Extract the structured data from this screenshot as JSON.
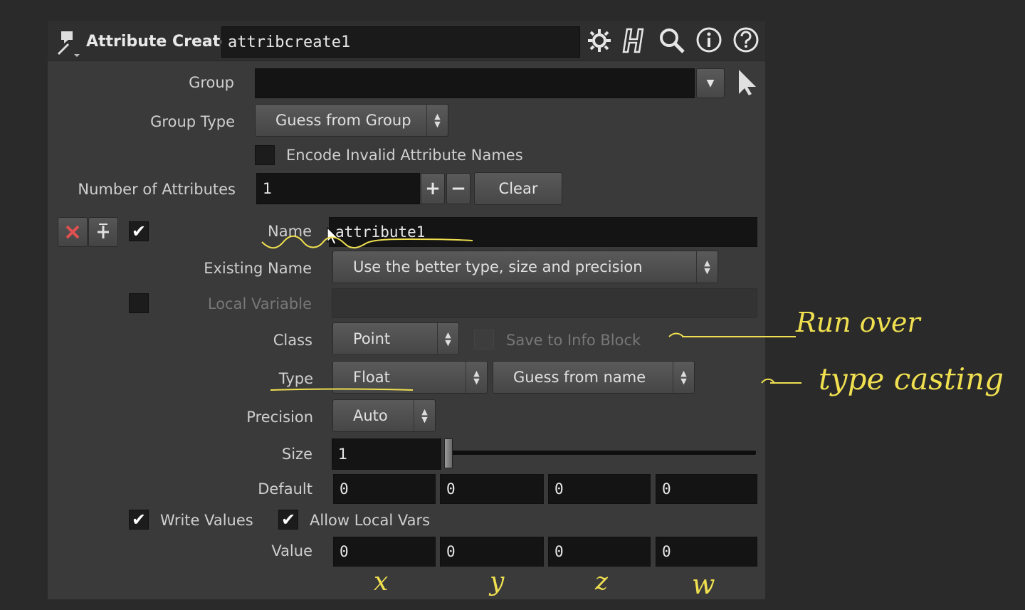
{
  "header": {
    "node_type": "Attribute Create",
    "node_name": "attribcreate1",
    "icons": [
      "gear-icon",
      "houdini-h-icon",
      "magnifier-icon",
      "info-icon",
      "help-icon"
    ]
  },
  "params": {
    "group": {
      "label": "Group",
      "value": ""
    },
    "group_type": {
      "label": "Group Type",
      "value": "Guess from Group"
    },
    "encode_invalid": {
      "label": "Encode Invalid Attribute Names",
      "checked": false
    },
    "num_attributes": {
      "label": "Number of Attributes",
      "value": "1",
      "plus": "+",
      "minus": "−",
      "clear": "Clear"
    },
    "name": {
      "label": "Name",
      "value": "attribute1"
    },
    "existing_name": {
      "label": "Existing Name",
      "value": "Use the better type, size and precision"
    },
    "local_variable": {
      "label": "Local Variable",
      "value": ""
    },
    "class": {
      "label": "Class",
      "value": "Point"
    },
    "save_info": {
      "label": "Save to Info Block"
    },
    "type": {
      "label": "Type",
      "value": "Float",
      "qualifier": "Guess from name"
    },
    "precision": {
      "label": "Precision",
      "value": "Auto"
    },
    "size": {
      "label": "Size",
      "value": "1",
      "slider_fraction": 0.0
    },
    "default": {
      "label": "Default",
      "values": [
        "0",
        "0",
        "0",
        "0"
      ]
    },
    "write_values": {
      "label": "Write Values",
      "checked": true
    },
    "allow_local_vars": {
      "label": "Allow Local Vars",
      "checked": true
    },
    "value": {
      "label": "Value",
      "values": [
        "0",
        "0",
        "0",
        "0"
      ]
    }
  },
  "annotations": {
    "run_over": "Run over",
    "type_casting": "type casting",
    "x": "x",
    "y": "y",
    "z": "z",
    "w": "w"
  },
  "colors": {
    "annotation": "#f0e050",
    "panel": "#3a3a3a",
    "field": "#141414"
  }
}
